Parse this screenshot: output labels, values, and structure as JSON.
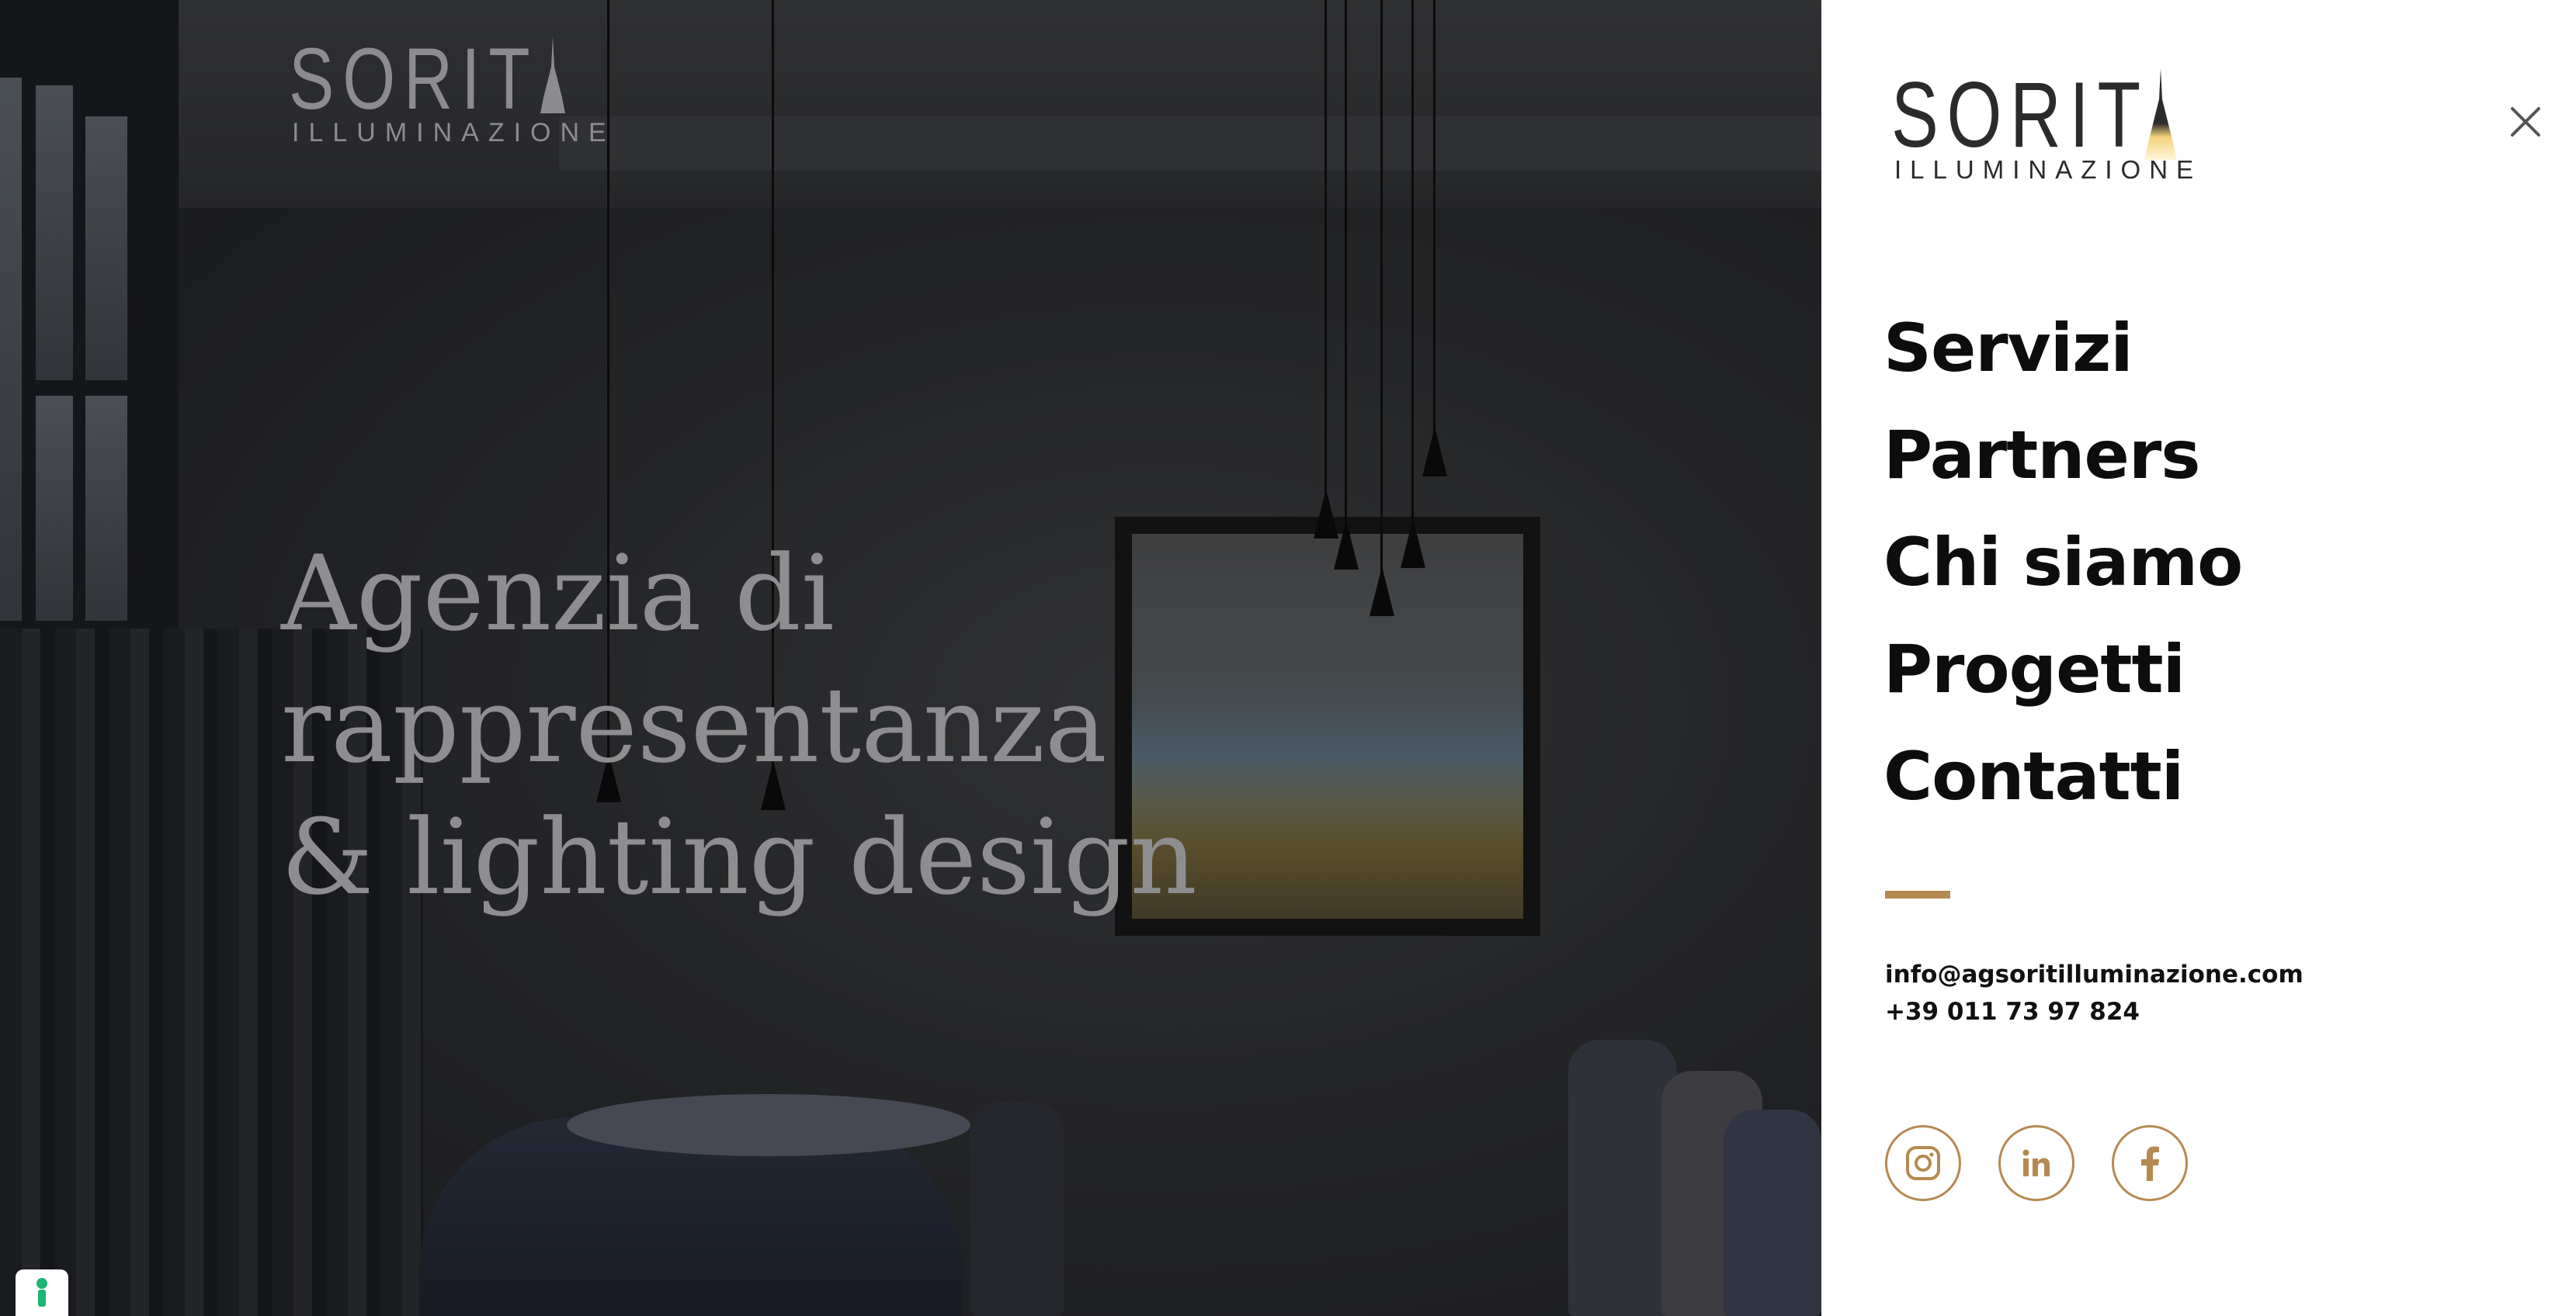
{
  "hero": {
    "logo_word": "SORIT",
    "logo_sub": "ILLUMINAZIONE",
    "title_line1": "Agenzia di rappresentanza",
    "title_line2": "& lighting design"
  },
  "menu": {
    "logo_word": "SORIT",
    "logo_sub": "ILLUMINAZIONE",
    "close_icon": "close-icon",
    "items": [
      {
        "label": "Servizi"
      },
      {
        "label": "Partners"
      },
      {
        "label": "Chi siamo"
      },
      {
        "label": "Progetti"
      },
      {
        "label": "Contatti"
      }
    ],
    "email": "info@agsoritilluminazione.com",
    "phone": "+39 011 73 97 824",
    "socials": [
      {
        "icon": "instagram-icon"
      },
      {
        "icon": "linkedin-icon"
      },
      {
        "icon": "facebook-icon"
      }
    ]
  },
  "colors": {
    "accent": "#b58a51",
    "menu_text": "#0d0d0d",
    "menu_bg": "#ffffff"
  }
}
